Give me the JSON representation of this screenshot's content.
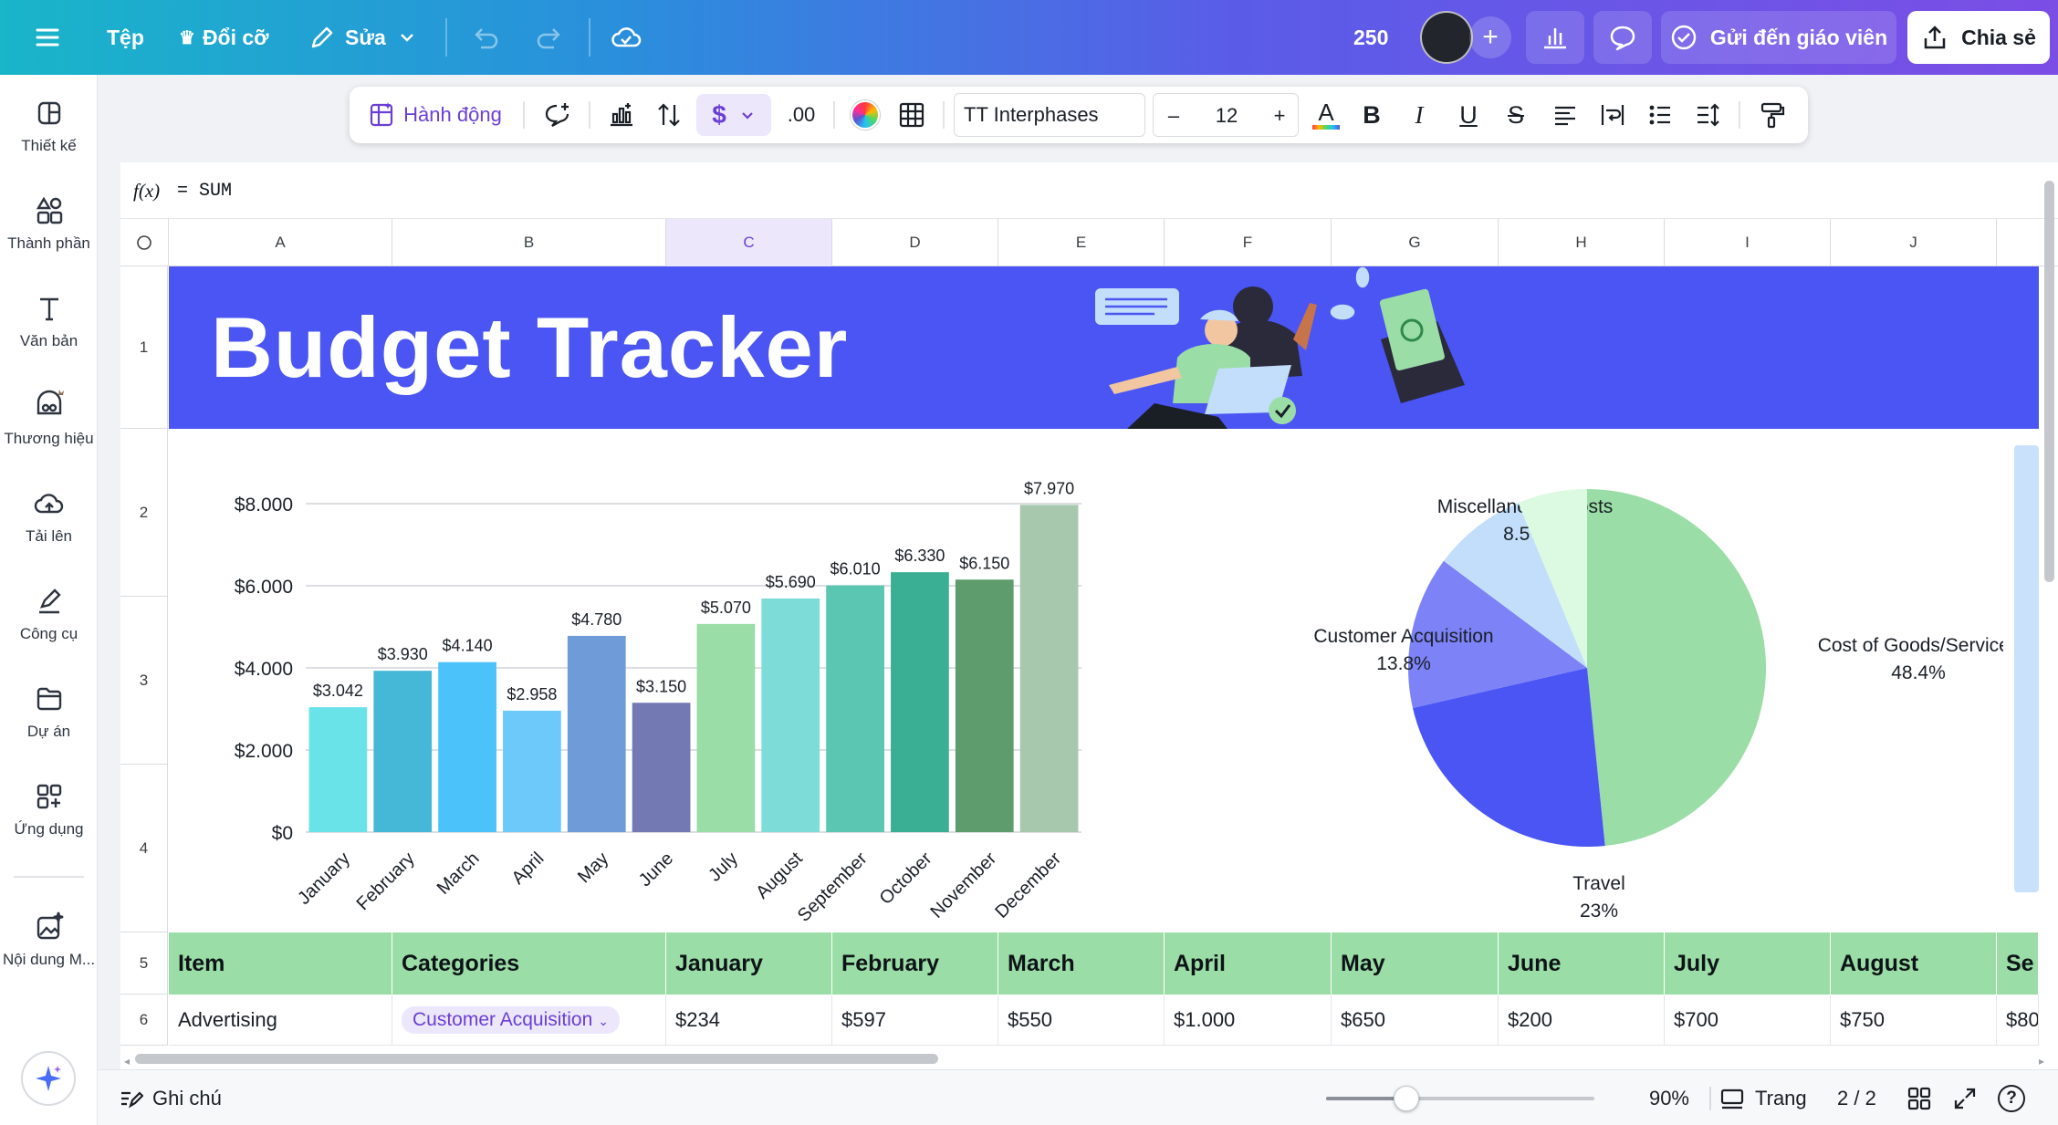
{
  "topbar": {
    "file_label": "Tệp",
    "resize_label": "Đổi cỡ",
    "edit_label": "Sửa",
    "count": "250",
    "send_label": "Gửi đến giáo viên",
    "share_label": "Chia sẻ"
  },
  "leftrail": {
    "items": [
      {
        "label": "Thiết kế"
      },
      {
        "label": "Thành phần"
      },
      {
        "label": "Văn bản"
      },
      {
        "label": "Thương hiệu"
      },
      {
        "label": "Tải lên"
      },
      {
        "label": "Công cụ"
      },
      {
        "label": "Dự án"
      },
      {
        "label": "Ứng dụng"
      },
      {
        "label": "Nội dung M..."
      }
    ]
  },
  "format_toolbar": {
    "actions_label": "Hành động",
    "decimal_label": ".00",
    "font_name": "TT Interphases",
    "font_size": "12",
    "minus": "–",
    "plus": "+",
    "text_color_letter": "A",
    "bold": "B",
    "italic": "I",
    "underline": "U",
    "strike": "S"
  },
  "formula": {
    "fx_label": "f(x)",
    "value": "= SUM"
  },
  "sheet": {
    "columns": [
      "A",
      "B",
      "C",
      "D",
      "E",
      "F",
      "G",
      "H",
      "I",
      "J"
    ],
    "rows": [
      "1",
      "2",
      "3",
      "4",
      "5",
      "6"
    ],
    "banner_title": "Budget Tracker",
    "table_header": [
      "Item",
      "Categories",
      "January",
      "February",
      "March",
      "April",
      "May",
      "June",
      "July",
      "August",
      "Se"
    ],
    "table_row_1": [
      "Advertising",
      "Customer Acquisition",
      "$234",
      "$597",
      "$550",
      "$1.000",
      "$650",
      "$200",
      "$700",
      "$750",
      "$80"
    ]
  },
  "chart_data": [
    {
      "type": "bar",
      "categories": [
        "January",
        "February",
        "March",
        "April",
        "May",
        "June",
        "July",
        "August",
        "September",
        "October",
        "November",
        "December"
      ],
      "values": [
        3042,
        3930,
        4140,
        2958,
        4780,
        3150,
        5070,
        5690,
        6010,
        6330,
        6150,
        7970
      ],
      "data_labels": [
        "$3.042",
        "$3.930",
        "$4.140",
        "$2.958",
        "$4.780",
        "$3.150",
        "$5.070",
        "$5.690",
        "$6.010",
        "$6.330",
        "$6.150",
        "$7.970"
      ],
      "yticks": [
        "$0",
        "$2.000",
        "$4.000",
        "$6.000",
        "$8.000"
      ],
      "ylim": [
        0,
        8000
      ],
      "colors": [
        "#6ae3e8",
        "#45b8d8",
        "#4cc2fb",
        "#6ec9fb",
        "#6f9bd8",
        "#7279b3",
        "#9bdda6",
        "#7ddcd8",
        "#5bc7b2",
        "#3aaf94",
        "#5e9c6e",
        "#a8c8ad"
      ],
      "grid": true
    },
    {
      "type": "pie",
      "slices": [
        {
          "label": "Cost of Goods/Services",
          "pct_text": "48.4%",
          "value": 48.4,
          "color": "#9bdda6"
        },
        {
          "label": "Travel",
          "pct_text": "23%",
          "value": 23,
          "color": "#4a55f4"
        },
        {
          "label": "Customer Acquisition",
          "pct_text": "13.8%",
          "value": 13.8,
          "color": "#7d82f7"
        },
        {
          "label": "Miscellaneous Costs",
          "pct_text": "8.5%",
          "value": 8.5,
          "color": "#c2defa"
        },
        {
          "label": "",
          "pct_text": "",
          "value": 6.3,
          "color": "#dcf9e2"
        }
      ]
    }
  ],
  "bottombar": {
    "notes_label": "Ghi chú",
    "zoom_value": 0.3,
    "zoom_label": "90%",
    "page_label": "Trang",
    "page_count": "2 / 2",
    "help": "?"
  },
  "colors": {
    "banner": "#4a55f4",
    "header_green": "#9bdda6",
    "accent": "#7d2ae8"
  }
}
